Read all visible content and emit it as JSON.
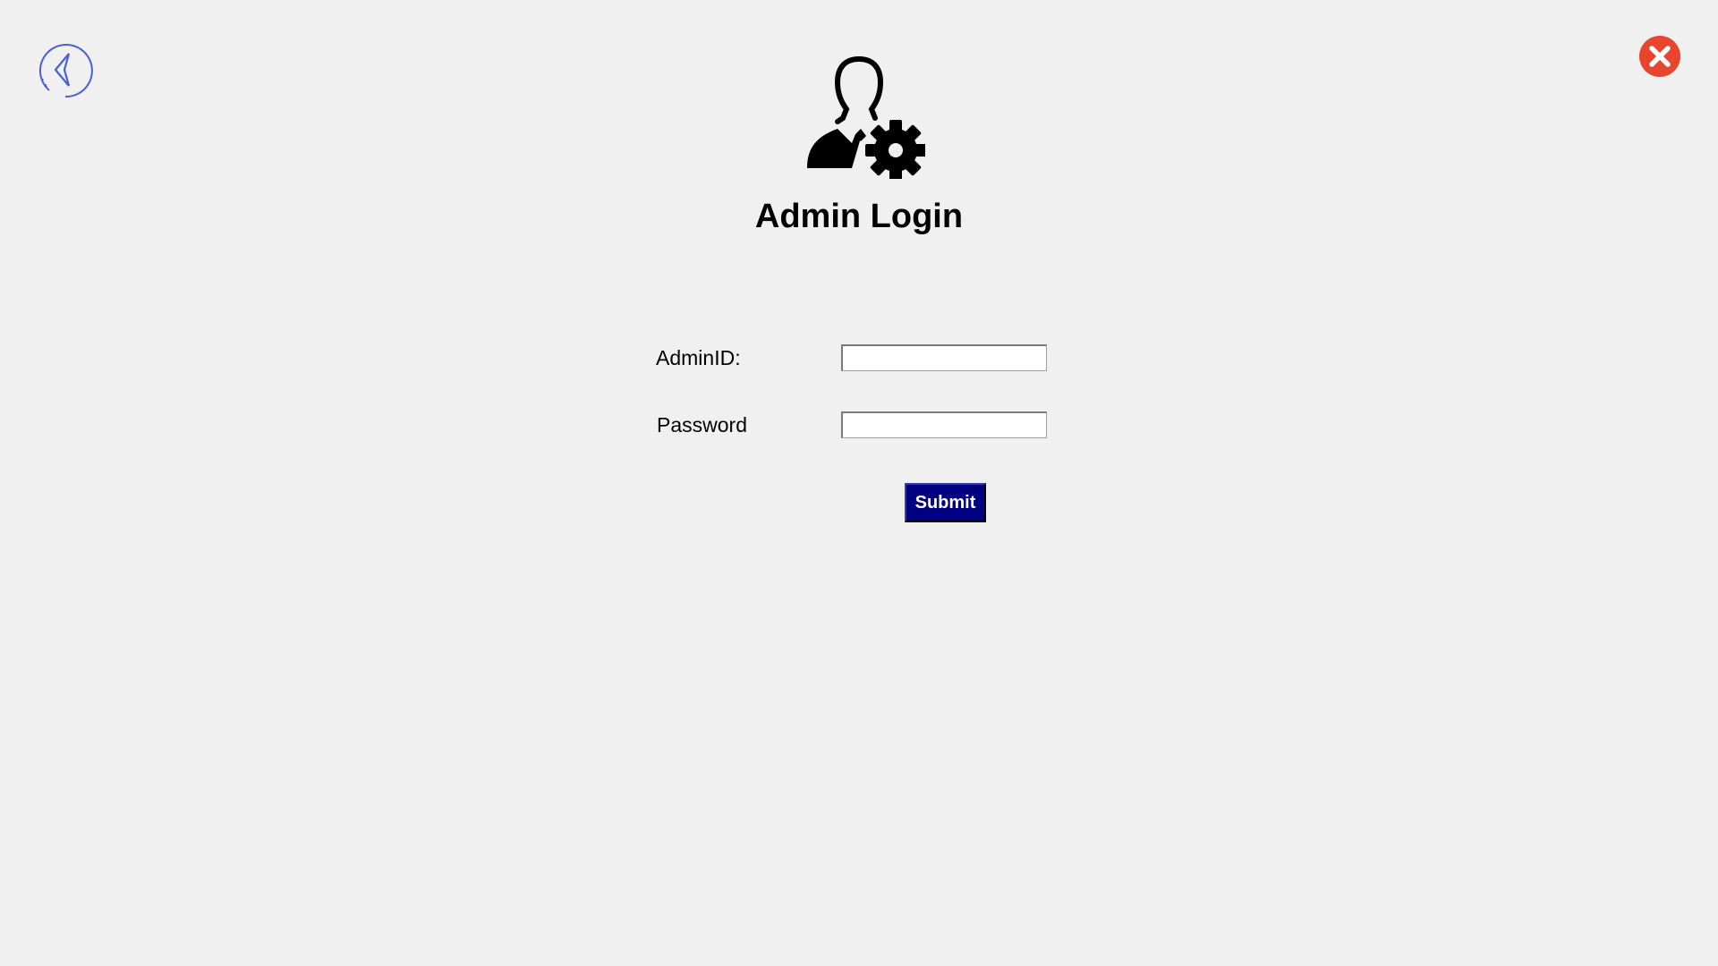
{
  "header": {
    "title": "Admin Login",
    "back_icon": "back-arrow-icon",
    "close_icon": "close-icon",
    "admin_icon": "admin-settings-icon"
  },
  "form": {
    "adminid_label": "AdminID:",
    "adminid_value": "",
    "password_label": "Password",
    "password_value": "",
    "submit_label": "Submit"
  },
  "colors": {
    "background": "#f0f0f0",
    "submit_bg": "#000080",
    "close_red": "#e8452f",
    "back_blue": "#4a5fd6"
  }
}
